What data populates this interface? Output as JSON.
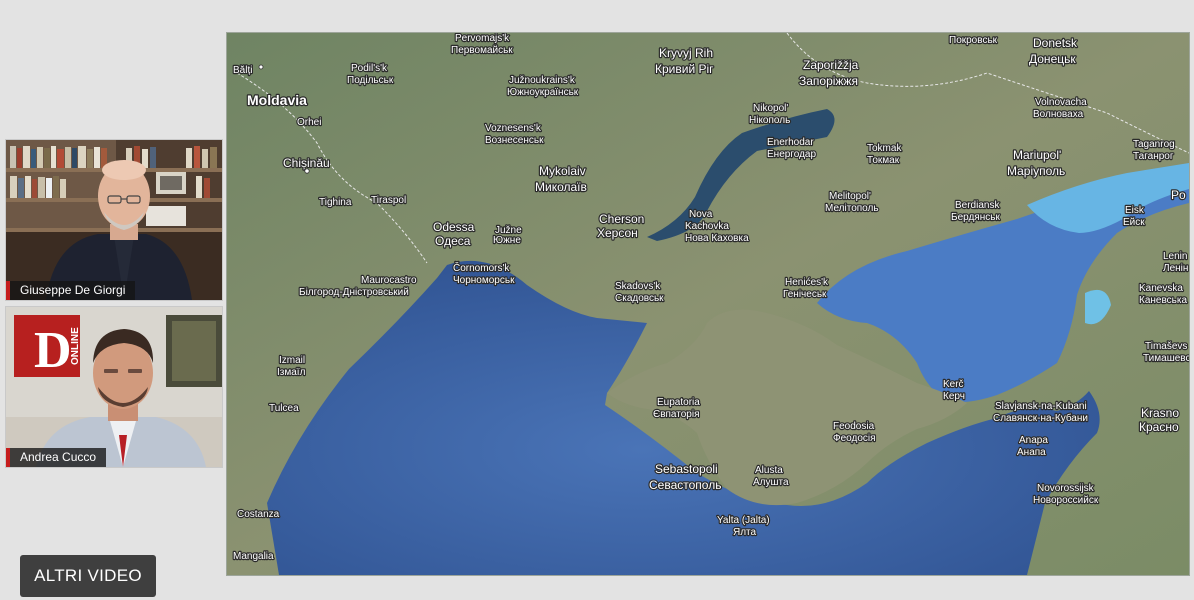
{
  "participants": [
    {
      "name": "Giuseppe De Giorgi"
    },
    {
      "name": "Andrea Cucco"
    }
  ],
  "logo": {
    "letter": "D",
    "word": "ONLINE"
  },
  "map": {
    "labels": {
      "balti": "Bălți",
      "moldavia": "Moldavia",
      "podilsk": "Podil's'k",
      "podilsk_uk": "Подільськ",
      "pervomajsk": "Pervomajs'k",
      "pervomajsk_uk": "Первомайськ",
      "kryvyj": "Kryvyj Rih",
      "kryvyj_uk": "Кривий Ріг",
      "zaporizzja": "Zaporižžja",
      "zaporizzja_uk": "Запоріжжя",
      "pokrovsk_uk": "Покровськ",
      "donetsk": "Donetsk",
      "donetsk_uk": "Донецьк",
      "orhei": "Orhei",
      "juznoukr": "Južnoukrains'k",
      "juznoukr_uk": "Южноукраїнськ",
      "nikopol": "Nikopol'",
      "nikopol_uk": "Нікополь",
      "volnovacha": "Volnovacha",
      "volnovacha_uk": "Волноваха",
      "voznesensk": "Voznesens'k",
      "voznesensk_uk": "Вознесенськ",
      "enerhodar": "Enerhodar",
      "enerhodar_uk": "Енергодар",
      "tokmak": "Tokmak",
      "tokmak_uk": "Токмак",
      "taganrog": "Taganrog",
      "taganrog_uk": "Таганрог",
      "chisinau": "Chișinău",
      "mykolaiv": "Mykolaiv",
      "mykolaiv_uk": "Миколаїв",
      "mariupol": "Mariupol'",
      "mariupol_uk": "Маріуполь",
      "tighina": "Tighina",
      "tiraspol": "Tiraspol",
      "melitopol": "Melitopol'",
      "melitopol_uk": "Мелітополь",
      "berdiansk": "Berdiansk",
      "berdiansk_uk": "Бердянськ",
      "eisk": "Eisk",
      "eisk_uk": "Ейск",
      "po": "Po",
      "odessa": "Odessa",
      "odessa_uk": "Одеса",
      "juzne": "Južne",
      "juzne_uk": "Южне",
      "cherson": "Cherson",
      "cherson_uk": "Херсон",
      "novakach": "Nova",
      "novakach2": "Kachovka",
      "novakach_uk": "Нова Каховка",
      "chornomorsk": "Čornomors'k",
      "chornomorsk_uk": "Чорноморськ",
      "henicesk": "Henićes'k",
      "henicesk_uk": "Генічеськ",
      "lenin": "Lenin",
      "lenin_uk": "Ленін",
      "maurocastro": "Maurocastro",
      "bilhorod_uk": "Білгород-Дністровський",
      "skadovsk": "Skadovs'k",
      "skadovsk_uk": "Скадовськ",
      "kanevska": "Kanevska",
      "kanevska_uk": "Каневська",
      "izmail": "Izmail",
      "izmail_uk": "Ізмаїл",
      "timasev": "Timaševs",
      "timasev_uk": "Тимашевс",
      "kerc": "Kerč",
      "kerc_uk": "Керч",
      "eupatoria": "Eupatoria",
      "eupatoria_uk": "Євпаторія",
      "krasnod": "Krasno",
      "krasnod_uk": "Красно",
      "tulcea": "Tulcea",
      "slavjansk": "Slavjansk-na-Kubani",
      "slavjansk_uk": "Славянск-на-Кубани",
      "feodosia": "Feodosia",
      "feodosia_uk": "Феодосія",
      "anapa": "Anapa",
      "anapa_uk": "Анапа",
      "sebastopoli": "Sebastopoli",
      "sebastopoli_uk": "Севастополь",
      "alusta": "Alusta",
      "alusta_uk": "Алушта",
      "novoross": "Novorossijsk",
      "novoross_uk": "Новороссийск",
      "costanza": "Costanza",
      "yalta": "Yalta (Jalta)",
      "yalta_uk": "Ялта",
      "mangalia": "Mangalia"
    },
    "colors": {
      "sea": "#3d64a6",
      "land": "#7d8f6a",
      "azov": "#5d8fd0",
      "shallow": "#6fc1e6",
      "border": "#e8e8e8"
    }
  },
  "buttons": {
    "more_videos": "ALTRI VIDEO"
  }
}
